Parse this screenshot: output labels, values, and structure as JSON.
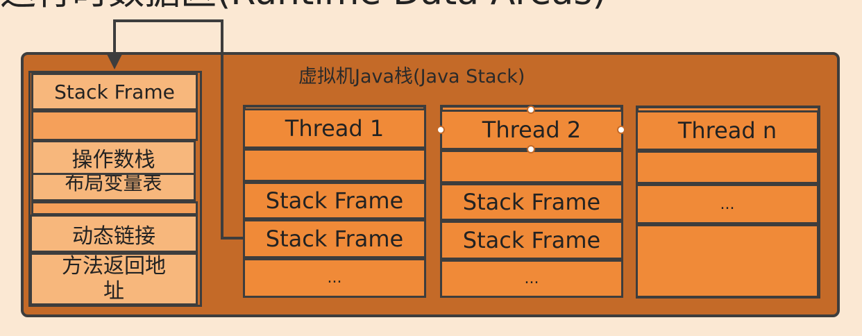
{
  "title": "运行时数据区(Runtime Data Areas)",
  "stack_label": "虚拟机Java栈(Java Stack)",
  "frame_detail": {
    "header": "Stack Frame",
    "items": [
      "操作数栈",
      "布局变量表",
      "动态链接",
      "方法返回地址"
    ]
  },
  "threads": [
    {
      "name": "Thread 1",
      "rows": [
        "",
        "Stack Frame",
        "Stack Frame",
        "..."
      ]
    },
    {
      "name": "Thread 2",
      "rows": [
        "",
        "Stack Frame",
        "Stack Frame",
        "..."
      ]
    },
    {
      "name": "Thread n",
      "rows": [
        "",
        "...",
        ""
      ]
    }
  ],
  "colors": {
    "panel": "#c46a28",
    "cell": "#f08a38",
    "light_cell": "#f7b77c",
    "border": "#3d3d3d",
    "background": "#fbe8d3"
  }
}
